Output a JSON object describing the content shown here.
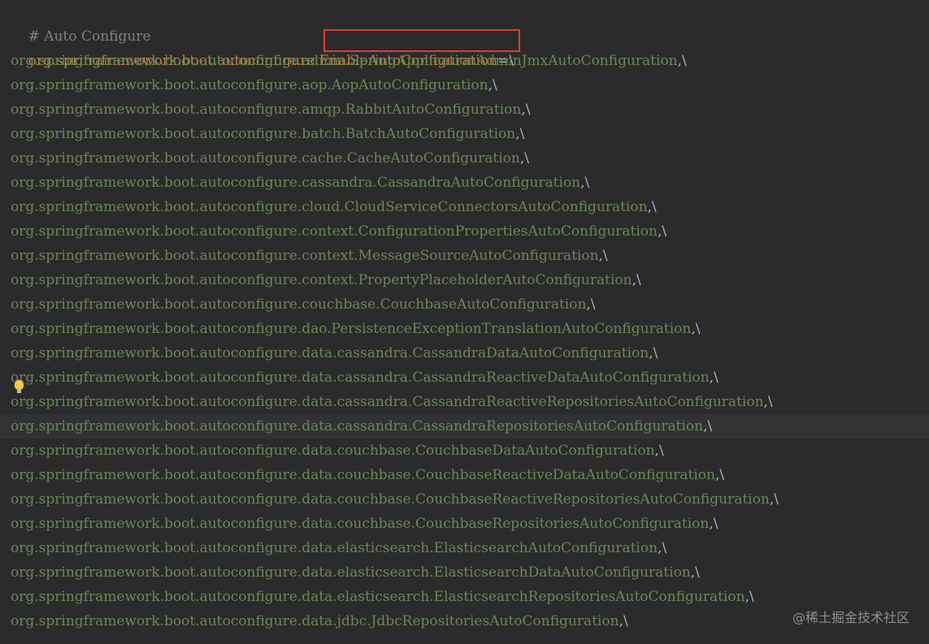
{
  "comment": "# Auto Configure",
  "first_line": {
    "prefix": "org.springframework.boot.autoconfigure.",
    "key": "EnableAutoConfiguration",
    "sep": "=",
    "cont": "\\"
  },
  "lines": [
    "org.springframework.boot.autoconfigure.admin.SpringApplicationAdminJmxAutoConfiguration,\\",
    "org.springframework.boot.autoconfigure.aop.AopAutoConfiguration,\\",
    "org.springframework.boot.autoconfigure.amqp.RabbitAutoConfiguration,\\",
    "org.springframework.boot.autoconfigure.batch.BatchAutoConfiguration,\\",
    "org.springframework.boot.autoconfigure.cache.CacheAutoConfiguration,\\",
    "org.springframework.boot.autoconfigure.cassandra.CassandraAutoConfiguration,\\",
    "org.springframework.boot.autoconfigure.cloud.CloudServiceConnectorsAutoConfiguration,\\",
    "org.springframework.boot.autoconfigure.context.ConfigurationPropertiesAutoConfiguration,\\",
    "org.springframework.boot.autoconfigure.context.MessageSourceAutoConfiguration,\\",
    "org.springframework.boot.autoconfigure.context.PropertyPlaceholderAutoConfiguration,\\",
    "org.springframework.boot.autoconfigure.couchbase.CouchbaseAutoConfiguration,\\",
    "org.springframework.boot.autoconfigure.dao.PersistenceExceptionTranslationAutoConfiguration,\\",
    "org.springframework.boot.autoconfigure.data.cassandra.CassandraDataAutoConfiguration,\\",
    "org.springframework.boot.autoconfigure.data.cassandra.CassandraReactiveDataAutoConfiguration,\\",
    "org.springframework.boot.autoconfigure.data.cassandra.CassandraReactiveRepositoriesAutoConfiguration,\\",
    "org.springframework.boot.autoconfigure.data.cassandra.CassandraRepositoriesAutoConfiguration,\\",
    "org.springframework.boot.autoconfigure.data.couchbase.CouchbaseDataAutoConfiguration,\\",
    "org.springframework.boot.autoconfigure.data.couchbase.CouchbaseReactiveDataAutoConfiguration,\\",
    "org.springframework.boot.autoconfigure.data.couchbase.CouchbaseReactiveRepositoriesAutoConfiguration,\\",
    "org.springframework.boot.autoconfigure.data.couchbase.CouchbaseRepositoriesAutoConfiguration,\\",
    "org.springframework.boot.autoconfigure.data.elasticsearch.ElasticsearchAutoConfiguration,\\",
    "org.springframework.boot.autoconfigure.data.elasticsearch.ElasticsearchDataAutoConfiguration,\\",
    "org.springframework.boot.autoconfigure.data.elasticsearch.ElasticsearchRepositoriesAutoConfiguration,\\",
    "org.springframework.boot.autoconfigure.data.jdbc.JdbcRepositoriesAutoConfiguration,\\"
  ],
  "caret_line_index": 15,
  "intention_icon": "lightbulb-icon",
  "watermark": "@稀土掘金技术社区",
  "colors": {
    "background": "#2b2b2b",
    "caret_line": "#323232",
    "comment": "#808080",
    "property_key": "#c27e38",
    "property_value": "#6a8759",
    "highlight_box": "#e23b35"
  }
}
